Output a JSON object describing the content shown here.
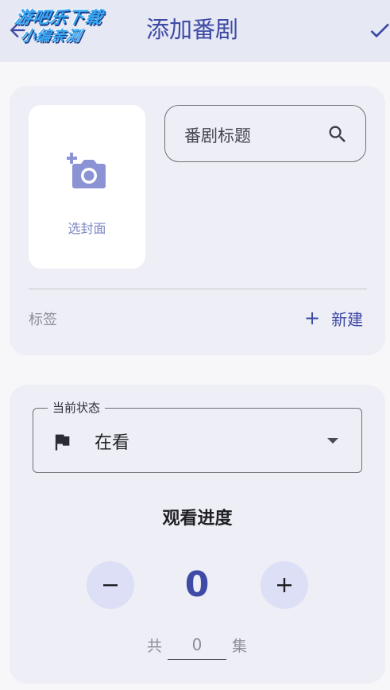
{
  "appbar": {
    "title": "添加番剧",
    "watermark_line1": "游吧乐下载",
    "watermark_line2": "小编亲测",
    "back_icon": "arrow-back-icon",
    "confirm_icon": "check-icon"
  },
  "cover": {
    "label": "选封面",
    "icon": "add-photo-icon"
  },
  "title_field": {
    "placeholder": "番剧标题",
    "icon": "search-icon"
  },
  "tags": {
    "label": "标签",
    "new_plus": "+",
    "new_label": "新建"
  },
  "status": {
    "legend": "当前状态",
    "value": "在看",
    "icon": "flag-icon"
  },
  "progress": {
    "title": "观看进度",
    "minus": "−",
    "plus": "+",
    "value": "0",
    "total_prefix": "共",
    "total_value": "0",
    "total_suffix": "集"
  },
  "colors": {
    "accent": "#3e4aa5",
    "appbar_bg": "#e6e8f4",
    "card_bg": "#eeeef6",
    "button_bg": "#dcdff6"
  }
}
